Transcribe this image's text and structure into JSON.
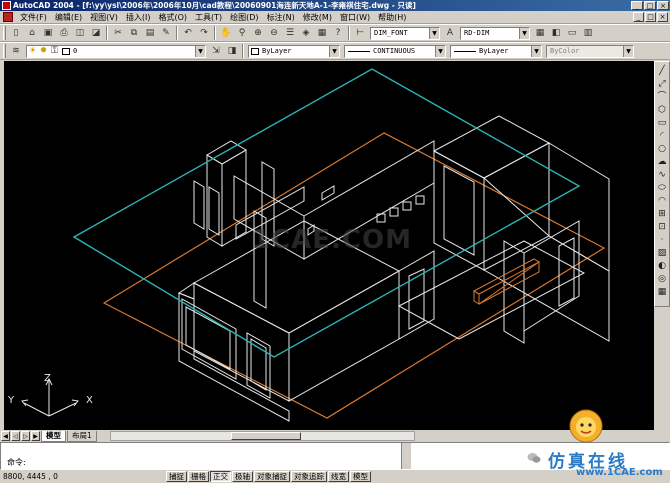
{
  "window": {
    "title": "AutoCAD 2004 - [f:\\yy\\ysl\\2006年\\2006年10月\\cad教程\\20060901海连新天地A-1-李雍祺住宅.dwg - 只读]",
    "buttons": [
      "_",
      "□",
      "×"
    ]
  },
  "menu": {
    "items": [
      "文件(F)",
      "编辑(E)",
      "视图(V)",
      "插入(I)",
      "格式(O)",
      "工具(T)",
      "绘图(D)",
      "标注(N)",
      "修改(M)",
      "窗口(W)",
      "帮助(H)"
    ]
  },
  "toolbar": {
    "dimstyle": "DIM_FONT",
    "textstyle": "RD-DIM"
  },
  "layers": {
    "current": "0"
  },
  "properties": {
    "color": "ByLayer",
    "linetype": "CONTINUOUS",
    "lineweight": "ByLayer",
    "plotstyle": "ByColor"
  },
  "ucs": {
    "x_label": "X",
    "y_label": "Y",
    "z_label": "Z"
  },
  "watermark": "1CAE.COM",
  "tabs": {
    "model": "模型",
    "layout1": "布局1"
  },
  "command": {
    "prompt": "命令:",
    "value": ""
  },
  "status": {
    "coordinates": "8800,  4445 , 0",
    "modes": [
      "捕捉",
      "栅格",
      "正交",
      "极轴",
      "对象捕捉",
      "对象追踪",
      "线宽",
      "模型"
    ]
  },
  "brand": {
    "name_cn": "仿真在线",
    "url": "www.1CAE.com"
  },
  "colors": {
    "slab": "#2bb3b3",
    "floor": "#d9782e",
    "walls": "#e8e8e8",
    "canvas": "#000000"
  }
}
